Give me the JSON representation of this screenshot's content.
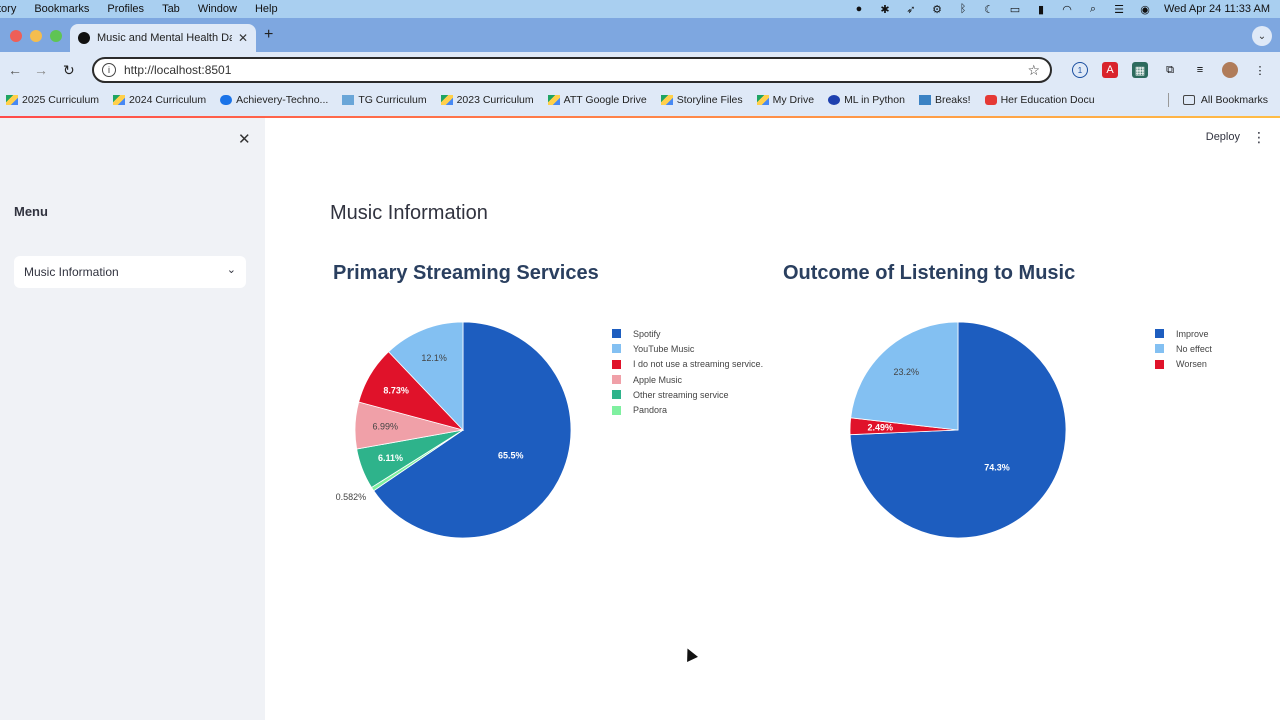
{
  "os_menubar": {
    "items": [
      "tory",
      "Bookmarks",
      "Profiles",
      "Tab",
      "Window",
      "Help"
    ],
    "datetime": "Wed Apr 24  11:33 AM"
  },
  "browser": {
    "tab_title": "Music and Mental Health Das",
    "url": "http://localhost:8501",
    "bookmarks": [
      "2025 Curriculum",
      "2024 Curriculum",
      "Achievery-Techno...",
      "TG Curriculum",
      "2023 Curriculum",
      "ATT Google Drive",
      "Storyline Files",
      "My Drive",
      "ML in Python",
      "Breaks!",
      "Her Education Docu"
    ],
    "all_bookmarks": "All Bookmarks"
  },
  "sidebar": {
    "menu_label": "Menu",
    "selected": "Music Information"
  },
  "main": {
    "deploy_label": "Deploy",
    "page_title": "Music Information"
  },
  "colors": {
    "spotify": "#1d5dbf",
    "youtube": "#83c0f2",
    "none": "#e0122a",
    "apple": "#f0a0a8",
    "other": "#2eb38b",
    "pandora": "#7ff0a0"
  },
  "chart_data": [
    {
      "type": "pie",
      "title": "Primary Streaming Services",
      "series": [
        {
          "label": "Spotify",
          "value": 65.5,
          "label_text": "65.5%",
          "color": "#1d5dbf"
        },
        {
          "label": "YouTube Music",
          "value": 12.1,
          "label_text": "12.1%",
          "color": "#83c0f2"
        },
        {
          "label": "I do not use a streaming service.",
          "value": 8.73,
          "label_text": "8.73%",
          "color": "#e0122a"
        },
        {
          "label": "Apple Music",
          "value": 6.99,
          "label_text": "6.99%",
          "color": "#f0a0a8"
        },
        {
          "label": "Other streaming service",
          "value": 6.11,
          "label_text": "6.11%",
          "color": "#2eb38b"
        },
        {
          "label": "Pandora",
          "value": 0.582,
          "label_text": "0.582%",
          "color": "#7ff0a0"
        }
      ],
      "legend_position": "right"
    },
    {
      "type": "pie",
      "title": "Outcome of Listening to Music",
      "series": [
        {
          "label": "Improve",
          "value": 74.3,
          "label_text": "74.3%",
          "color": "#1d5dbf"
        },
        {
          "label": "No effect",
          "value": 23.2,
          "label_text": "23.2%",
          "color": "#83c0f2"
        },
        {
          "label": "Worsen",
          "value": 2.49,
          "label_text": "2.49%",
          "color": "#e0122a"
        }
      ],
      "legend_position": "right"
    }
  ]
}
